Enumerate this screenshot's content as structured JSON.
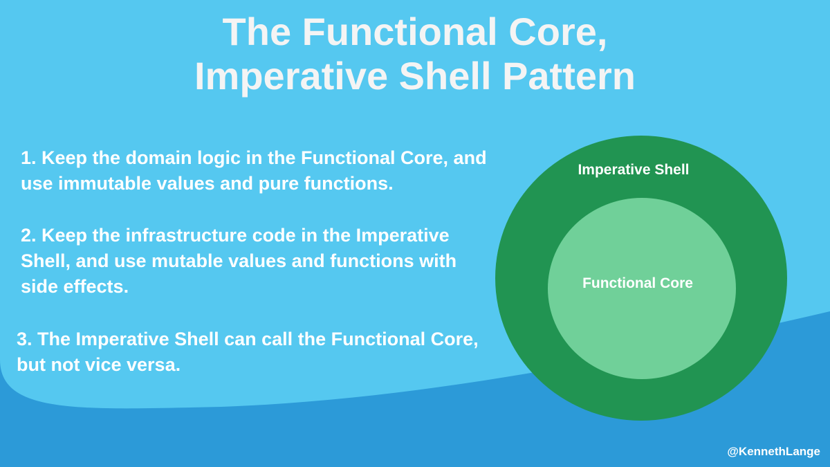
{
  "title": {
    "line1": "The Functional Core,",
    "line2": "Imperative Shell Pattern"
  },
  "points": [
    {
      "text": "1. Keep the domain logic in the Functional Core, and use immutable values and pure functions."
    },
    {
      "text": "2. Keep the infrastructure code in the Imperative Shell, and use mutable values and functions with side effects."
    },
    {
      "text": "3. The Imperative Shell can call the Functional Core, but not vice versa."
    }
  ],
  "diagram": {
    "outer_label": "Imperative Shell",
    "inner_label": "Functional Core",
    "outer_color": "#219452",
    "inner_color": "#70d099"
  },
  "footer": {
    "handle": "@KennethLange"
  },
  "colors": {
    "background_light": "#55c8f0",
    "background_wave": "#2c9ad8",
    "text": "#ffffff"
  }
}
